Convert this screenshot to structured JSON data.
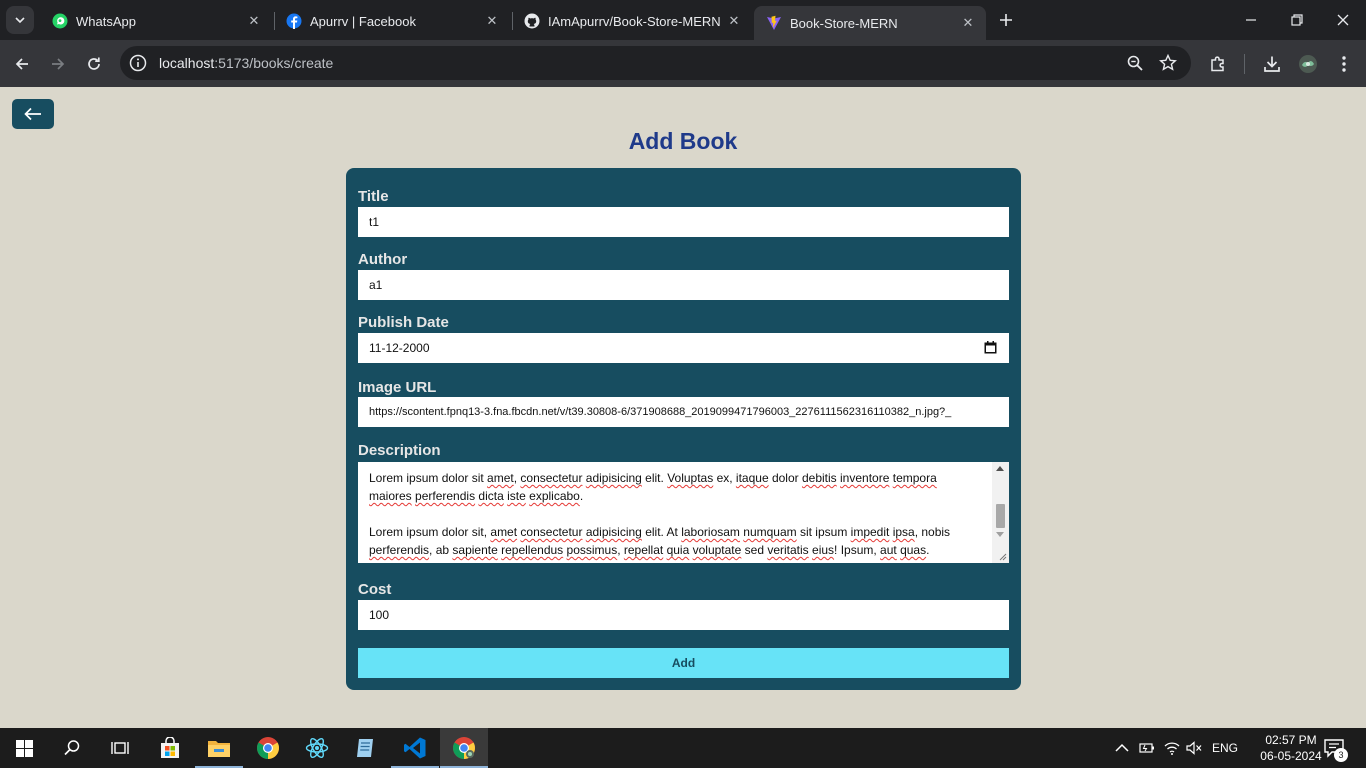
{
  "browser": {
    "tabs": [
      {
        "title": "WhatsApp",
        "icon": "whatsapp-icon",
        "active": false
      },
      {
        "title": "Apurrv | Facebook",
        "icon": "facebook-icon",
        "active": false
      },
      {
        "title": "IAmApurrv/Book-Store-MERN",
        "icon": "github-icon",
        "active": false
      },
      {
        "title": "Book-Store-MERN",
        "icon": "vite-icon",
        "active": true
      }
    ],
    "url_host": "localhost",
    "url_path": ":5173/books/create"
  },
  "page": {
    "back_icon": "arrow-left-icon",
    "title": "Add Book",
    "form": {
      "title_label": "Title",
      "title_value": "t1",
      "author_label": "Author",
      "author_value": "a1",
      "publish_date_label": "Publish Date",
      "publish_date_value": "11-12-2000",
      "image_url_label": "Image URL",
      "image_url_value": "https://scontent.fpnq13-3.fna.fbcdn.net/v/t39.30808-6/371908688_2019099471796003_2276111562316110382_n.jpg?_",
      "description_label": "Description",
      "description_p1": {
        "a": "Lorem ipsum dolor sit ",
        "b": "amet",
        "c": ", ",
        "d": "consectetur",
        "e": " ",
        "f": "adipisicing",
        "g": " elit. ",
        "h": "Voluptas",
        "i": " ex, ",
        "j": "itaque",
        "k": " dolor ",
        "l": "debitis",
        "m": " ",
        "n": "inventore",
        "o": " ",
        "p": "tempora",
        "q": "maiores",
        "r": " ",
        "s": "perferendis",
        "t": " ",
        "u": "dicta",
        "v": " ",
        "w": "iste",
        "x": " ",
        "y": "explicabo",
        "z": "."
      },
      "description_p2": {
        "a": "Lorem ipsum dolor sit, ",
        "b": "amet",
        "c": " ",
        "d": "consectetur",
        "e": " ",
        "f": "adipisicing",
        "g": " elit. At ",
        "h": "laboriosam",
        "i": " ",
        "j": "numquam",
        "k": " sit ipsum ",
        "l": "impedit",
        "m": " ",
        "n": "ipsa",
        "o": ", nobis",
        "p": "perferendis",
        "q": ", ab ",
        "r": "sapiente",
        "s": " ",
        "t": "repellendus",
        "u": " ",
        "v": "possimus",
        "w": ", ",
        "x": "repellat",
        "y": " ",
        "z": "quia",
        "aa": " ",
        "ab": "voluptate",
        "ac": " sed ",
        "ad": "veritatis",
        "ae": " ",
        "af": "eius",
        "ag": "! Ipsum, ",
        "ah": "aut",
        "ai": " ",
        "aj": "quas",
        "ak": "."
      },
      "cost_label": "Cost",
      "cost_value": "100",
      "submit_label": "Add"
    }
  },
  "taskbar": {
    "language": "ENG",
    "time": "02:57 PM",
    "date": "06-05-2024",
    "notification_count": "3"
  }
}
